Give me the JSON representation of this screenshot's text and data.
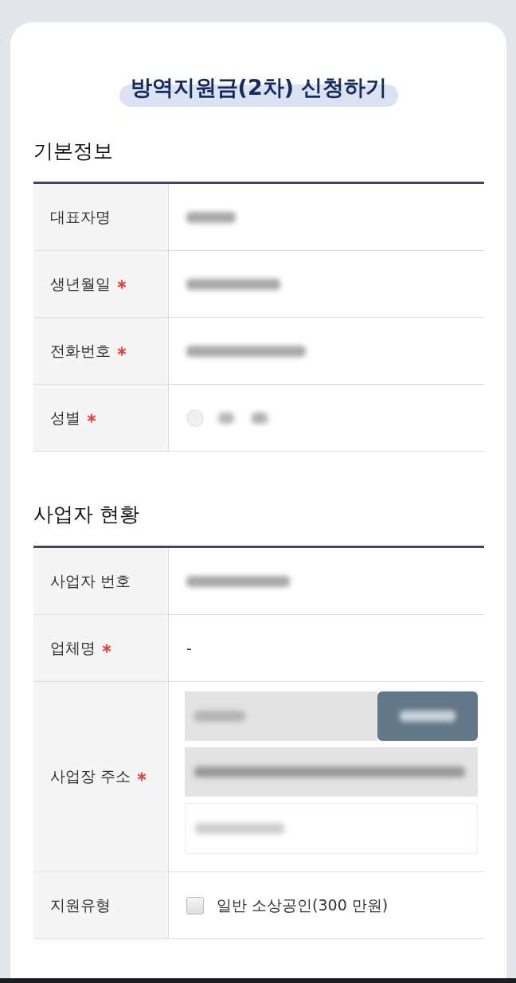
{
  "title": "방역지원금(2차) 신청하기",
  "sections": [
    {
      "heading": "기본정보",
      "rows": [
        {
          "label": "대표자명",
          "required": false,
          "kind": "blurred"
        },
        {
          "label": "생년월일",
          "required": true,
          "kind": "blurred"
        },
        {
          "label": "전화번호",
          "required": true,
          "kind": "blurred"
        },
        {
          "label": "성별",
          "required": true,
          "kind": "radio",
          "options": [
            {
              "selected": false
            }
          ]
        }
      ]
    },
    {
      "heading": "사업자 현황",
      "rows": [
        {
          "label": "사업자 번호",
          "required": false,
          "kind": "blurred"
        },
        {
          "label": "업체명",
          "required": true,
          "kind": "text",
          "value": "-"
        },
        {
          "label": "사업장 주소",
          "required": true,
          "kind": "address"
        },
        {
          "label": "지원유형",
          "required": false,
          "kind": "checkbox",
          "option": {
            "label": "일반 소상공인(300 만원)",
            "checked": false
          }
        }
      ]
    }
  ]
}
